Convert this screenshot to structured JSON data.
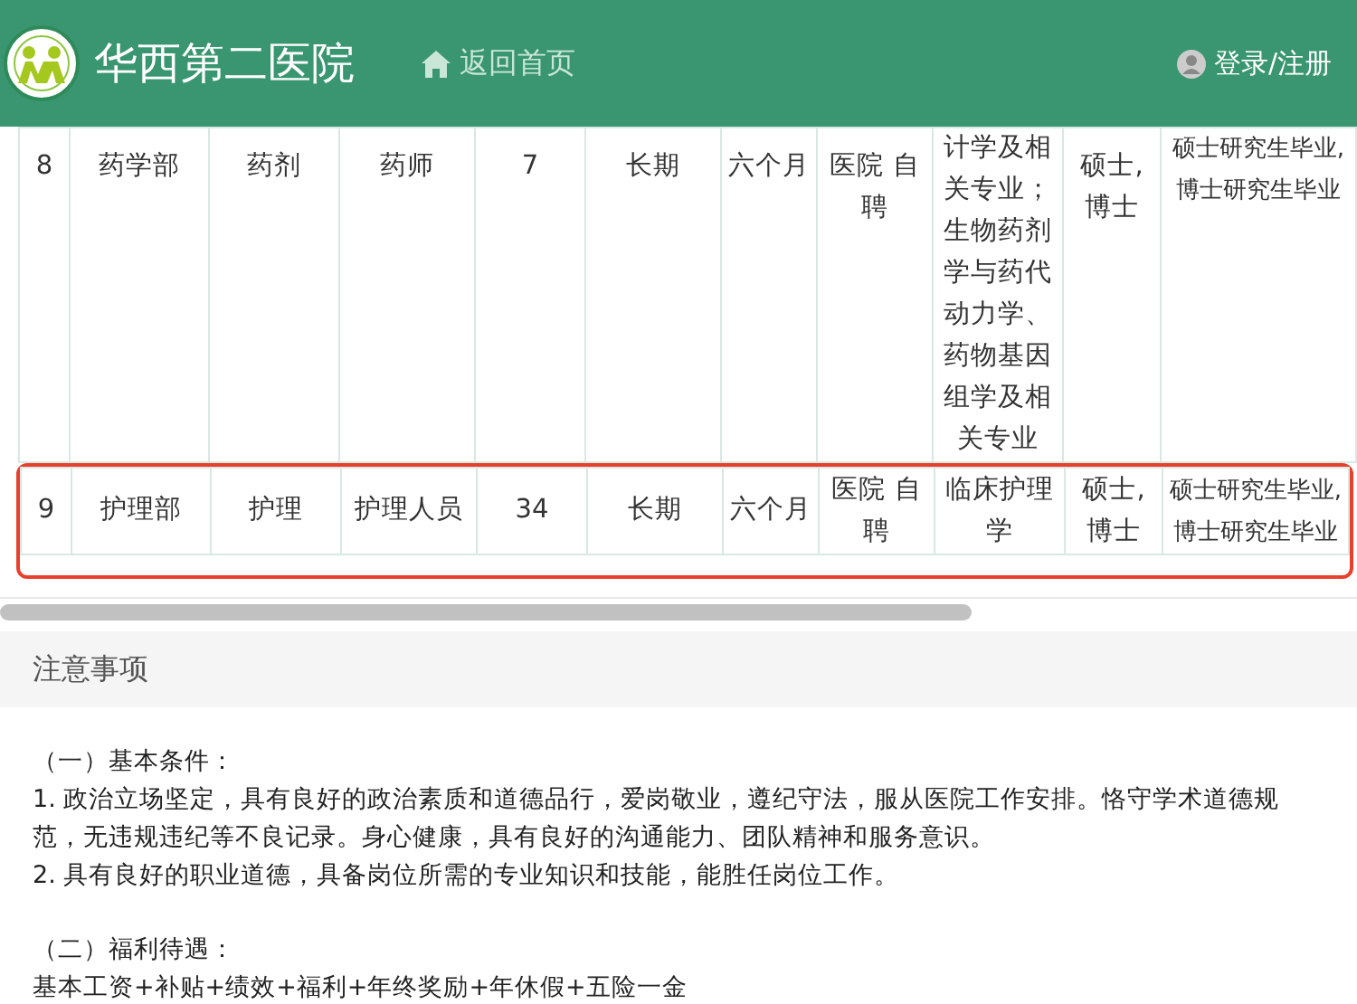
{
  "header": {
    "title": "华西第二医院",
    "home_link": "返回首页",
    "login": "登录/注册"
  },
  "table": {
    "rows": [
      {
        "highlighted": false,
        "cells": [
          "8",
          "药学部",
          "药剂",
          "药师",
          "7",
          "长期",
          "六个月",
          "医院 自聘",
          "计学及相关专业；生物药剂学与药代动力学、药物基因组学及相关专业",
          "硕士,博士",
          "硕士研究生毕业,博士研究生毕业"
        ]
      },
      {
        "highlighted": true,
        "cells": [
          "9",
          "护理部",
          "护理",
          "护理人员",
          "34",
          "长期",
          "六个月",
          "医院 自聘",
          "临床护理学",
          "硕士,博士",
          "硕士研究生毕业,博士研究生毕业"
        ]
      }
    ]
  },
  "notice": {
    "title": "注意事项",
    "sections": [
      {
        "heading": "（一）基本条件：",
        "lines": [
          "1. 政治立场坚定，具有良好的政治素质和道德品行，爱岗敬业，遵纪守法，服从医院工作安排。恪守学术道德规范，无违规违纪等不良记录。身心健康，具有良好的沟通能力、团队精神和服务意识。",
          "2. 具有良好的职业道德，具备岗位所需的专业知识和技能，能胜任岗位工作。"
        ]
      },
      {
        "heading": "（二）福利待遇：",
        "lines": [
          "基本工资+补贴+绩效+福利+年终奖励+年休假+五险一金"
        ]
      }
    ]
  }
}
